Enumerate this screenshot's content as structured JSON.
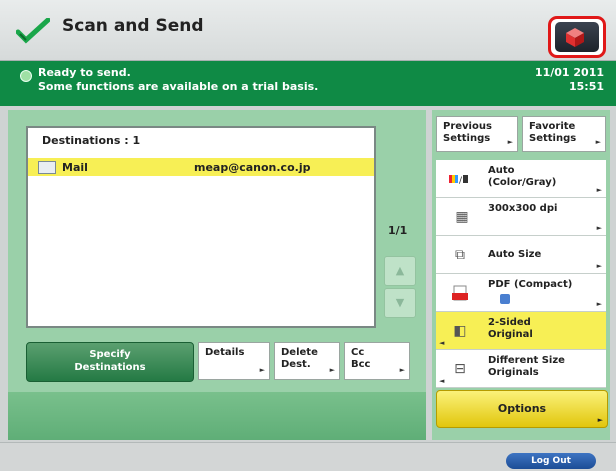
{
  "header": {
    "title": "Scan and Send",
    "logo_icon": "send-check-icon",
    "top_button_icon": "cube-icon",
    "colors": {
      "accent_red": "#e01818"
    }
  },
  "status": {
    "line1": "Ready to send.",
    "line2": "Some functions are available on a trial basis.",
    "date": "11/01 2011",
    "time": "15:51",
    "bg_color": "#0f8a45"
  },
  "destinations": {
    "header": "Destinations  : 1",
    "rows": [
      {
        "type": "Mail",
        "address": "meap@canon.co.jp",
        "icon": "mail-icon"
      }
    ],
    "pager": "1/1",
    "scroll_up": "▲",
    "scroll_down": "▼"
  },
  "actions": {
    "specify_line1": "Specify",
    "specify_line2": "Destinations",
    "details": "Details",
    "delete_line1": "Delete",
    "delete_line2": "Dest.",
    "cc_line1": "Cc",
    "cc_line2": "Bcc"
  },
  "settings": {
    "previous_line1": "Previous",
    "previous_line2": "Settings",
    "favorite_line1": "Favorite",
    "favorite_line2": "Settings",
    "items": [
      {
        "line1": "Auto",
        "line2": "(Color/Gray)",
        "icon": "color-mode-icon"
      },
      {
        "line1": "300x300 dpi",
        "line2": "",
        "icon": "resolution-icon"
      },
      {
        "line1": "Auto Size",
        "line2": "",
        "icon": "size-icon"
      },
      {
        "line1": "PDF (Compact)",
        "line2": "",
        "icon": "pdf-icon"
      },
      {
        "line1": "2-Sided",
        "line2": "Original",
        "icon": "two-sided-icon"
      },
      {
        "line1": "Different Size",
        "line2": "Originals",
        "icon": "different-size-icon"
      }
    ],
    "options": "Options"
  },
  "footer": {
    "logout": "Log Out"
  }
}
